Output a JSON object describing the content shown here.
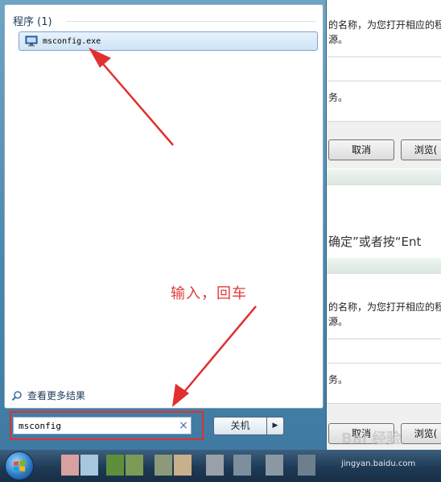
{
  "background": {
    "lines": [
      "的名称，为您打开相应的程",
      "源。",
      "务。",
      "的名称，为您打开相应的程",
      "源。",
      "务。"
    ],
    "cancel_label": "取消",
    "browse_label": "浏览(",
    "enter_text": "确定”或者按“Ent"
  },
  "start_menu": {
    "section_title": "程序 (1)",
    "result_label": "msconfig.exe",
    "more_results": "查看更多结果",
    "search_value": "msconfig",
    "clear_symbol": "×",
    "shutdown_label": "关机",
    "shutdown_arrow": "▶"
  },
  "annotation": {
    "text": "输入，回车",
    "color": "#e03a3a"
  },
  "taskbar": {
    "watermark": "Bai 经验",
    "watermark_url": "jingyan.baidu.com"
  },
  "colors": {
    "accent": "#3f7aa2",
    "highlight": "#cfe4f6",
    "annotation_red": "#e03030"
  }
}
